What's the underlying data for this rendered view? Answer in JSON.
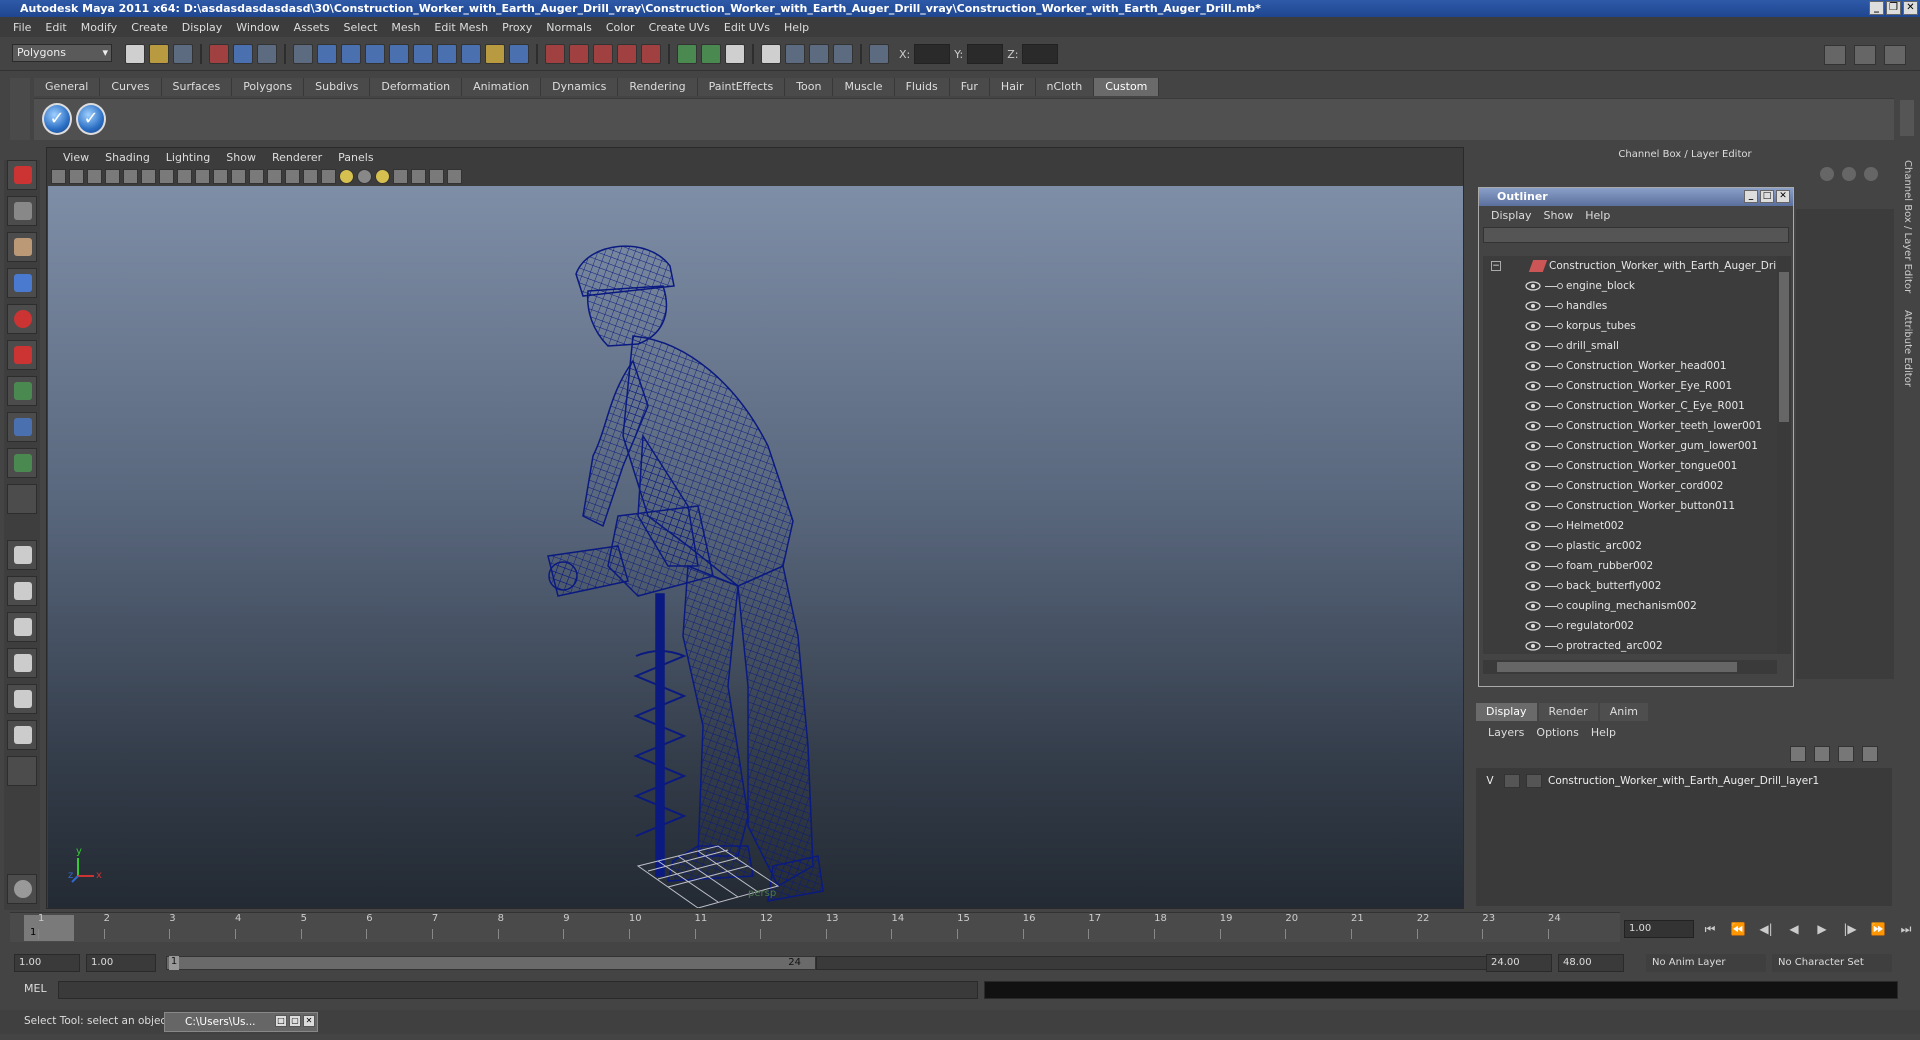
{
  "window": {
    "title": "Autodesk Maya 2011 x64: D:\\asdasdasdasdasd\\30\\Construction_Worker_with_Earth_Auger_Drill_vray\\Construction_Worker_with_Earth_Auger_Drill_vray\\Construction_Worker_with_Earth_Auger_Drill.mb*"
  },
  "menubar": [
    "File",
    "Edit",
    "Modify",
    "Create",
    "Display",
    "Window",
    "Assets",
    "Select",
    "Mesh",
    "Edit Mesh",
    "Proxy",
    "Normals",
    "Color",
    "Create UVs",
    "Edit UVs",
    "Help"
  ],
  "status": {
    "mode": "Polygons",
    "x_label": "X:",
    "y_label": "Y:",
    "z_label": "Z:"
  },
  "shelf": {
    "tabs": [
      "General",
      "Curves",
      "Surfaces",
      "Polygons",
      "Subdivs",
      "Deformation",
      "Animation",
      "Dynamics",
      "Rendering",
      "PaintEffects",
      "Toon",
      "Muscle",
      "Fluids",
      "Fur",
      "Hair",
      "nCloth",
      "Custom"
    ],
    "active_tab": "Custom"
  },
  "viewport": {
    "menu": [
      "View",
      "Shading",
      "Lighting",
      "Show",
      "Renderer",
      "Panels"
    ],
    "camera_label": "persp",
    "axis_y": "y",
    "axis_x": "x",
    "axis_z": "z",
    "wire_color": "#0a1a80"
  },
  "channel_box": {
    "title": "Channel Box / Layer Editor"
  },
  "side_tabs": [
    "Channel Box / Layer Editor",
    "Attribute Editor"
  ],
  "outliner": {
    "title": "Outliner",
    "menu": [
      "Display",
      "Show",
      "Help"
    ],
    "root": "Construction_Worker_with_Earth_Auger_Drill",
    "items": [
      "engine_block",
      "handles",
      "korpus_tubes",
      "drill_small",
      "Construction_Worker_head001",
      "Construction_Worker_Eye_R001",
      "Construction_Worker_C_Eye_R001",
      "Construction_Worker_teeth_lower001",
      "Construction_Worker_gum_lower001",
      "Construction_Worker_tongue001",
      "Construction_Worker_cord002",
      "Construction_Worker_button011",
      "Helmet002",
      "plastic_arc002",
      "foam_rubber002",
      "back_butterfly002",
      "coupling_mechanism002",
      "regulator002",
      "protracted_arc002"
    ]
  },
  "layer_editor": {
    "tabs": [
      "Display",
      "Render",
      "Anim"
    ],
    "menu": [
      "Layers",
      "Options",
      "Help"
    ],
    "layers": [
      {
        "visible": "V",
        "name": "Construction_Worker_with_Earth_Auger_Drill_layer1"
      }
    ]
  },
  "timeline": {
    "ticks": [
      "1",
      "2",
      "3",
      "4",
      "5",
      "6",
      "7",
      "8",
      "9",
      "10",
      "11",
      "12",
      "13",
      "14",
      "15",
      "16",
      "17",
      "18",
      "19",
      "20",
      "21",
      "22",
      "23",
      "24"
    ],
    "current_frame": "1",
    "current_field": "1.00"
  },
  "range": {
    "start": "1.00",
    "playback_start": "1.00",
    "slider_start": "1",
    "slider_end": "24",
    "playback_end": "24.00",
    "end": "48.00",
    "anim_layer": "No Anim Layer",
    "character_set": "No Character Set"
  },
  "command": {
    "mel_label": "MEL"
  },
  "help_line": {
    "text": "Select Tool: select an object",
    "task": "C:\\Users\\Us..."
  }
}
